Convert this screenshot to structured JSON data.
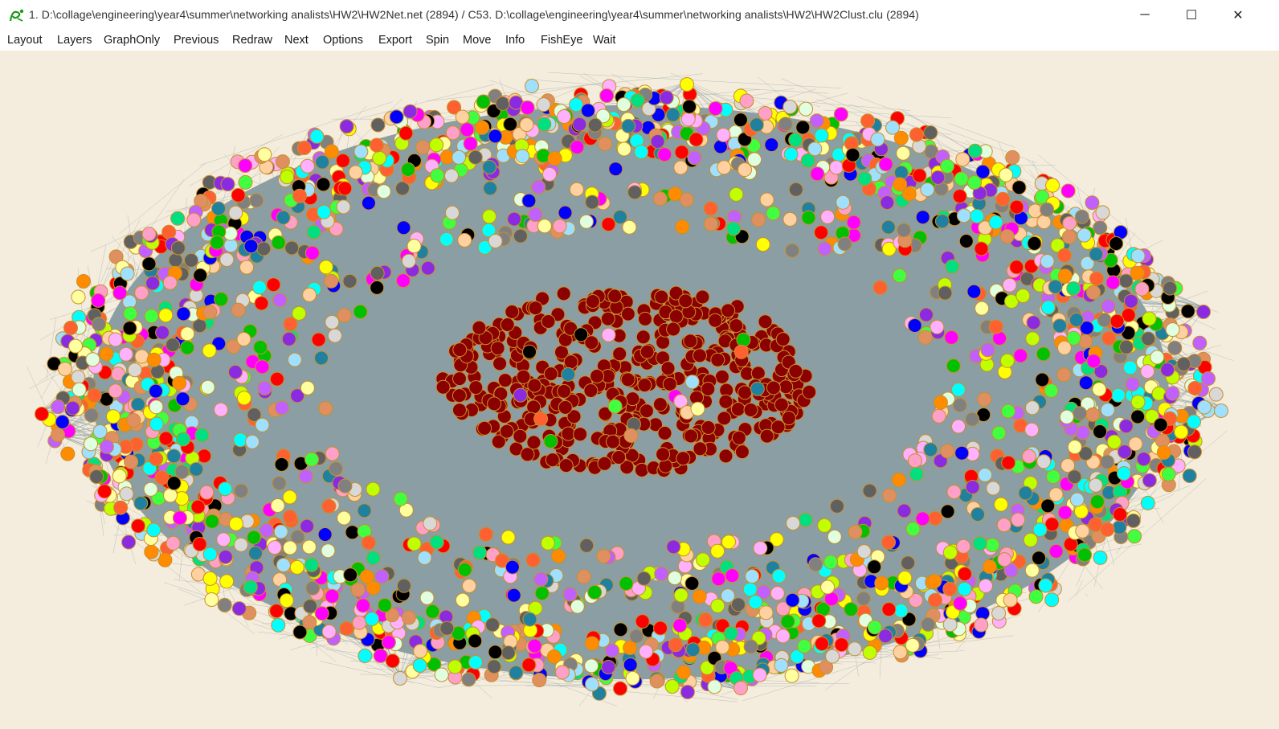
{
  "window": {
    "title": "1. D:\\collage\\engineering\\year4\\summer\\networking analists\\HW2\\HW2Net.net (2894) / C53. D:\\collage\\engineering\\year4\\summer\\networking analists\\HW2\\HW2Clust.clu (2894)",
    "icon": "pajek-app-icon",
    "controls": {
      "minimize": "─",
      "maximize": "☐",
      "close": "✕"
    }
  },
  "menu": [
    {
      "id": "layout",
      "label": "Layout"
    },
    {
      "id": "layers",
      "label": "Layers"
    },
    {
      "id": "graphonly",
      "label": "GraphOnly"
    },
    {
      "id": "previous",
      "label": "Previous"
    },
    {
      "id": "redraw",
      "label": "Redraw"
    },
    {
      "id": "next",
      "label": "Next"
    },
    {
      "id": "options",
      "label": "Options"
    },
    {
      "id": "export",
      "label": "Export"
    },
    {
      "id": "spin",
      "label": "Spin"
    },
    {
      "id": "move",
      "label": "Move"
    },
    {
      "id": "info",
      "label": "Info"
    },
    {
      "id": "fisheye",
      "label": "FishEye"
    },
    {
      "id": "wait",
      "label": "Wait"
    }
  ],
  "graph": {
    "background": "#f4ecdc",
    "edge_color": "#8a9ea4",
    "vertex_outline": "#c8902c",
    "central_cluster_color": "#8b0000",
    "palette": [
      "#ff0000",
      "#00c000",
      "#0000ff",
      "#ffff00",
      "#ff00ff",
      "#00ffff",
      "#ff8c00",
      "#8a2be2",
      "#000000",
      "#808080",
      "#ffa0c8",
      "#e0ffe0",
      "#c0ff00",
      "#ff6030",
      "#a0e0ff",
      "#606060",
      "#ffb0ff",
      "#d8d8d8",
      "#00e080",
      "#ffd0a0",
      "#2080a0",
      "#c060ff",
      "#ffffa0",
      "#40ff40",
      "#e09060"
    ]
  }
}
